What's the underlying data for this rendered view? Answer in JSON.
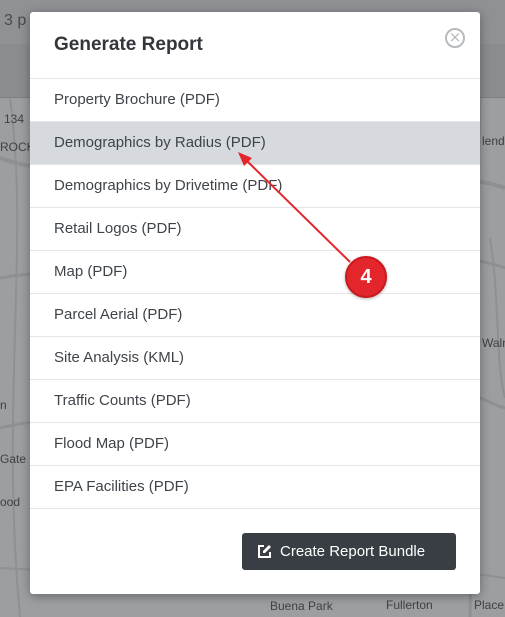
{
  "background": {
    "topbar_text": "3 p",
    "map_labels": [
      "134",
      "ROCK",
      "lendo",
      "Walnu",
      "n",
      "Gate",
      "ood",
      "Buena Park",
      "Fullerton",
      "Place"
    ]
  },
  "modal": {
    "title": "Generate Report",
    "close_icon": "close-circle-icon",
    "reports": [
      {
        "label": "Property Brochure (PDF)",
        "selected": false
      },
      {
        "label": "Demographics by Radius (PDF)",
        "selected": true
      },
      {
        "label": "Demographics by Drivetime (PDF)",
        "selected": false
      },
      {
        "label": "Retail Logos (PDF)",
        "selected": false
      },
      {
        "label": "Map (PDF)",
        "selected": false
      },
      {
        "label": "Parcel Aerial (PDF)",
        "selected": false
      },
      {
        "label": "Site Analysis (KML)",
        "selected": false
      },
      {
        "label": "Traffic Counts (PDF)",
        "selected": false
      },
      {
        "label": "Flood Map (PDF)",
        "selected": false
      },
      {
        "label": "EPA Facilities (PDF)",
        "selected": false
      }
    ],
    "bundle_button": {
      "label": "Create Report Bundle",
      "icon": "edit-icon"
    }
  },
  "annotation": {
    "step_number": "4",
    "color": "#e3262b"
  },
  "colors": {
    "selected_row": "#d6d9de",
    "button_bg": "#393e44",
    "title_text": "#33373c"
  }
}
